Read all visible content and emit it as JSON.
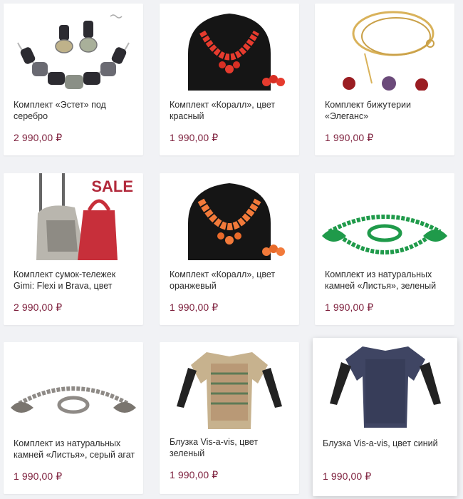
{
  "products": [
    {
      "title": "Комплект «Эстет» под серебро",
      "price": "2 990,00 ₽",
      "image_icon": "necklace-earrings-icon"
    },
    {
      "title": "Комплект «Коралл», цвет красный",
      "price": "1 990,00 ₽",
      "image_icon": "coral-necklace-icon"
    },
    {
      "title": "Комплект бижутерии «Элеганс»",
      "price": "1 990,00 ₽",
      "image_icon": "gold-chain-icon"
    },
    {
      "title": "Комплект сумок-тележек Gimi: Flexi и Brava, цвет",
      "price": "2 990,00 ₽",
      "image_icon": "shopping-trolley-icon",
      "badge": "SALE"
    },
    {
      "title": "Комплект «Коралл», цвет оранжевый",
      "price": "1 990,00 ₽",
      "image_icon": "coral-necklace-icon"
    },
    {
      "title": "Комплект из натуральных камней «Листья», зеленый",
      "price": "1 990,00 ₽",
      "image_icon": "stone-necklace-icon"
    },
    {
      "title": "Комплект из натуральных камней «Листья», серый агат",
      "price": "1 990,00 ₽",
      "image_icon": "stone-necklace-icon"
    },
    {
      "title": "Блузка Vis-a-vis, цвет зеленый",
      "price": "1 990,00 ₽",
      "image_icon": "blouse-icon"
    },
    {
      "title": "Блузка Vis-a-vis, цвет синий",
      "price": "1 990,00 ₽",
      "image_icon": "blouse-icon"
    }
  ],
  "colors": {
    "price": "#7d1f3c",
    "sale_badge": "#b22a3c",
    "coral_red": "#e63b2e",
    "coral_orange": "#f27a3a",
    "green_stone": "#1f9a4a",
    "grey_agate": "#8e8a86"
  }
}
